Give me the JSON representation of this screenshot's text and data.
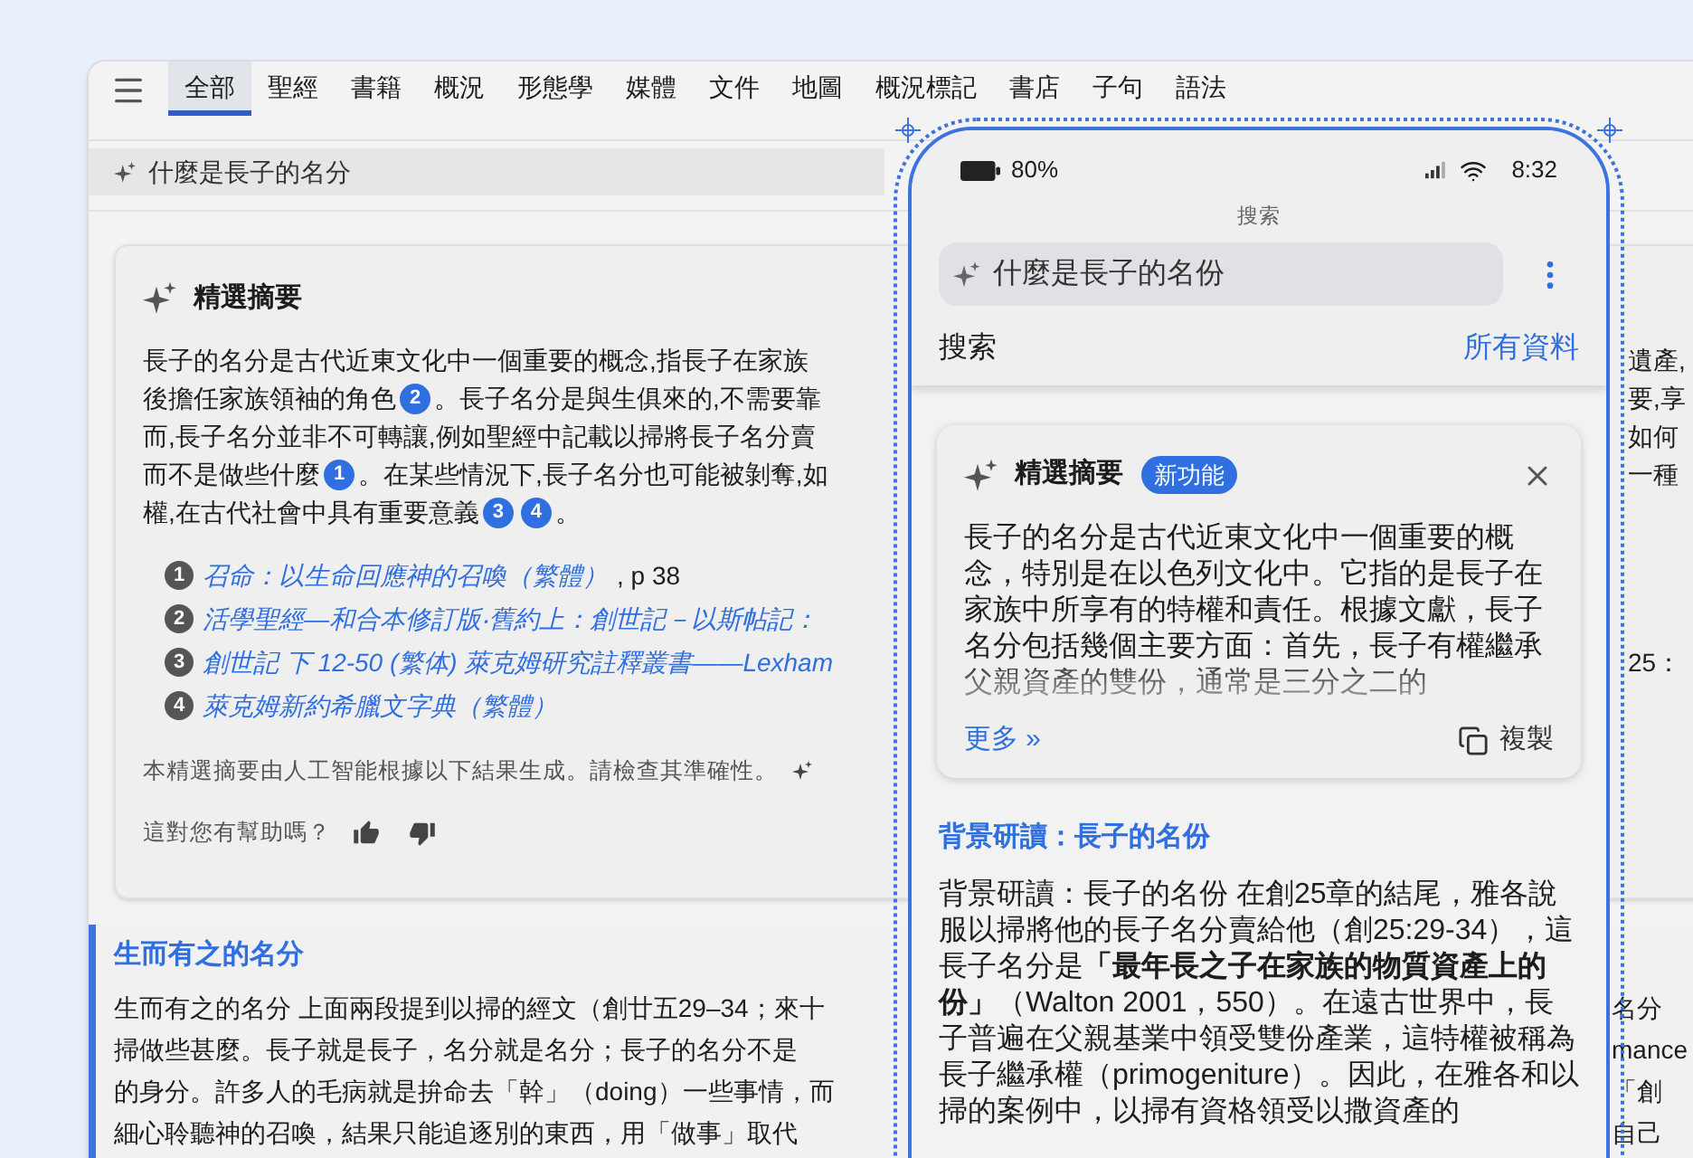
{
  "tabs": [
    {
      "label": "全部",
      "selected": true
    },
    {
      "label": "聖經",
      "selected": false
    },
    {
      "label": "書籍",
      "selected": false
    },
    {
      "label": "概況",
      "selected": false
    },
    {
      "label": "形態學",
      "selected": false
    },
    {
      "label": "媒體",
      "selected": false
    },
    {
      "label": "文件",
      "selected": false
    },
    {
      "label": "地圖",
      "selected": false
    },
    {
      "label": "概況標記",
      "selected": false
    },
    {
      "label": "書店",
      "selected": false
    },
    {
      "label": "子句",
      "selected": false
    },
    {
      "label": "語法",
      "selected": false
    }
  ],
  "query": "什麼是長子的名分",
  "summary": {
    "title": "精選摘要",
    "lines": [
      {
        "segments": [
          {
            "kind": "text",
            "text": "長子的名分是古代近東文化中一個重要的概念,指長子在家族"
          }
        ],
        "right": "遺產,"
      },
      {
        "segments": [
          {
            "kind": "text",
            "text": "後擔任家族領袖的角色"
          },
          {
            "kind": "cite",
            "text": "2"
          },
          {
            "kind": "text",
            "text": "。長子名分是與生俱來的,不需要靠"
          }
        ],
        "right": "要,享"
      },
      {
        "segments": [
          {
            "kind": "text",
            "text": "而,長子名分並非不可轉讓,例如聖經中記載以掃將長子名分賣"
          }
        ],
        "right": "如何"
      },
      {
        "segments": [
          {
            "kind": "text",
            "text": "而不是做些什麼"
          },
          {
            "kind": "cite",
            "text": "1"
          },
          {
            "kind": "text",
            "text": "。在某些情況下,長子名分也可能被剝奪,如"
          }
        ],
        "right": "一種"
      },
      {
        "segments": [
          {
            "kind": "text",
            "text": "權,在古代社會中具有重要意義"
          },
          {
            "kind": "cite",
            "text": "3"
          },
          {
            "kind": "cite",
            "text": "4"
          },
          {
            "kind": "text",
            "text": "。"
          }
        ]
      }
    ],
    "references": [
      {
        "number": "1",
        "title": "召命：以生命回應神的召喚（繁體）",
        "suffix": ", p 38"
      },
      {
        "number": "2",
        "title": "活學聖經—和合本修訂版‧舊約上：創世記－以斯帖記："
      },
      {
        "number": "3",
        "title": "創世記 下 12-50 (繁体) 萊克姆研究註釋叢書——Lexham",
        "right": "25："
      },
      {
        "number": "4",
        "title": "萊克姆新約希臘文字典（繁體）"
      }
    ],
    "disclaimer": "本精選摘要由人工智能根據以下結果生成。請檢查其準確性。",
    "feedback": "這對您有幫助嗎？"
  },
  "section": {
    "title": "生而有之的名分",
    "lines": [
      {
        "left": "生而有之的名分 上面兩段提到以掃的經文（創廿五29–34；來十",
        "right": "名分"
      },
      {
        "left": "掃做些甚麼。長子就是長子，名分就是名分；長子的名分不是",
        "right": "mance"
      },
      {
        "left": "的身分。許多人的毛病就是拚命去「幹」（doing）一些事情，而",
        "right": "「創"
      },
      {
        "left": "細心聆聽神的召喚，結果只能追逐別的東西，用「做事」取代",
        "right": "自己"
      }
    ]
  },
  "phone": {
    "battery": "80%",
    "time": "8:32",
    "header": "搜索",
    "search": "什麼是長子的名份",
    "scope_label": "搜索",
    "scope_value": "所有資料",
    "summary": {
      "title": "精選摘要",
      "badge": "新功能",
      "text": "長子的名分是古代近東文化中一個重要的概念，特別是在以色列文化中。它指的是長子在家族中所享有的特權和責任。根據文獻，長子名分包括幾個主要方面：首先，長子有權繼承父親資產的雙份，通常是三分之二的",
      "more": "更多 »",
      "copy": "複製"
    },
    "article": {
      "title": "背景研讀：長子的名份",
      "text": "背景研讀：長子的名份 在創25章的結尾，雅各說服以掃將他的長子名分賣給他（創25:29-34），這長子名分是**「最年長之子在家族的物質資產上的份」**（Walton 2001，550）。在遠古世界中，長子普遍在父親基業中領受雙份產業，這特權被稱為長子繼承權（primogeniture）。因此，在雅各和以掃的案例中，以掃有資格領受以撒資產的"
    }
  }
}
